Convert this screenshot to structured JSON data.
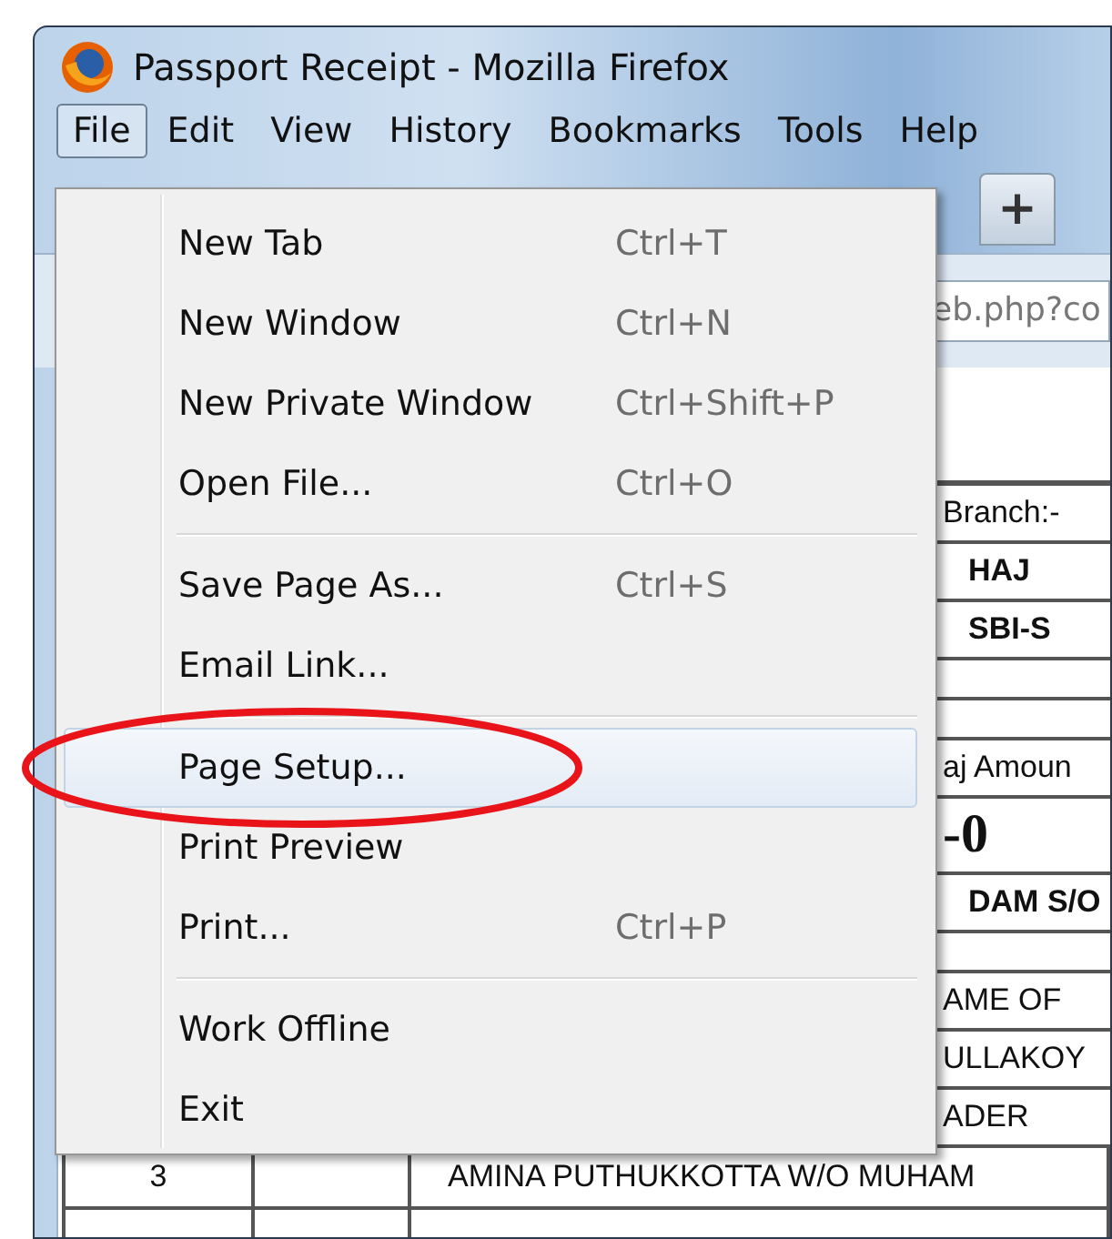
{
  "window": {
    "title": "Passport Receipt - Mozilla Firefox"
  },
  "menubar": [
    {
      "label": "File",
      "open": true
    },
    {
      "label": "Edit",
      "open": false
    },
    {
      "label": "View",
      "open": false
    },
    {
      "label": "History",
      "open": false
    },
    {
      "label": "Bookmarks",
      "open": false
    },
    {
      "label": "Tools",
      "open": false
    },
    {
      "label": "Help",
      "open": false
    }
  ],
  "tab_strip": {
    "new_tab_button": "+"
  },
  "address_bar": {
    "value": "eb.php?co"
  },
  "page": {
    "rows": [
      {
        "kind": "plain",
        "cells": [
          "Branch:-"
        ]
      },
      {
        "kind": "bold",
        "cells": [
          "HAJ"
        ]
      },
      {
        "kind": "bold",
        "cells": [
          "SBI-S"
        ]
      },
      {
        "kind": "blank"
      },
      {
        "kind": "blank"
      },
      {
        "kind": "plain",
        "cells": [
          "aj Amoun"
        ]
      },
      {
        "kind": "big",
        "cells": [
          "-0"
        ]
      },
      {
        "kind": "bold",
        "cells": [
          "DAM S/O"
        ]
      },
      {
        "kind": "blank"
      },
      {
        "kind": "plain",
        "cells": [
          "AME OF"
        ]
      },
      {
        "kind": "plain",
        "cells": [
          "ULLAKOY"
        ]
      },
      {
        "kind": "plain",
        "cells": [
          "ADER"
        ]
      },
      {
        "kind": "plain",
        "cells": [
          "3",
          "",
          "AMINA PUTHUKKOTTA W/O MUHAM"
        ]
      },
      {
        "kind": "grid_blank"
      }
    ]
  },
  "file_menu": {
    "items": [
      {
        "kind": "item",
        "label": "New Tab",
        "shortcut": "Ctrl+T",
        "selected": false
      },
      {
        "kind": "item",
        "label": "New Window",
        "shortcut": "Ctrl+N",
        "selected": false
      },
      {
        "kind": "item",
        "label": "New Private Window",
        "shortcut": "Ctrl+Shift+P",
        "selected": false
      },
      {
        "kind": "item",
        "label": "Open File...",
        "shortcut": "Ctrl+O",
        "selected": false
      },
      {
        "kind": "separator"
      },
      {
        "kind": "item",
        "label": "Save Page As...",
        "shortcut": "Ctrl+S",
        "selected": false
      },
      {
        "kind": "item",
        "label": "Email Link...",
        "selected": false
      },
      {
        "kind": "separator"
      },
      {
        "kind": "item",
        "label": "Page Setup...",
        "selected": true
      },
      {
        "kind": "item",
        "label": "Print Preview",
        "selected": false
      },
      {
        "kind": "item",
        "label": "Print...",
        "shortcut": "Ctrl+P",
        "selected": false
      },
      {
        "kind": "separator"
      },
      {
        "kind": "item",
        "label": "Work Offline",
        "selected": false
      },
      {
        "kind": "item",
        "label": "Exit",
        "selected": false
      }
    ]
  },
  "annotation": {
    "kind": "ellipse"
  }
}
